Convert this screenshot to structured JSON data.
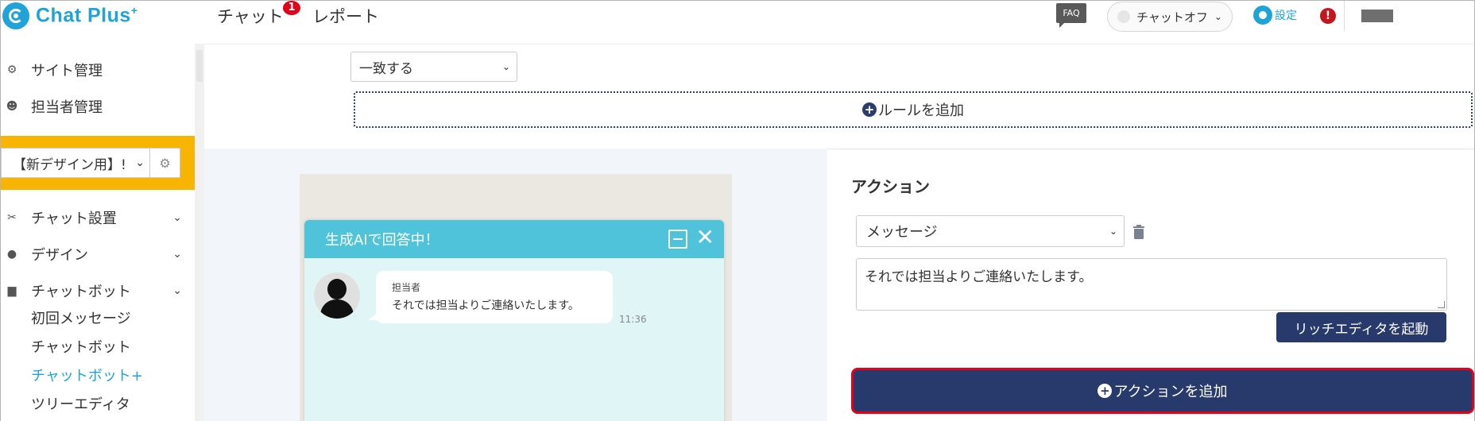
{
  "header": {
    "logo_text": "Chat Plus",
    "logo_sup": "+",
    "nav": [
      {
        "label": "チャット",
        "badge": "1"
      },
      {
        "label": "レポート"
      }
    ],
    "faq_label": "FAQ",
    "chat_status_label": "チャットオフ",
    "settings_label": "設定",
    "alert_label": "!"
  },
  "sidebar": {
    "items": [
      {
        "label": "サイト管理",
        "icon": "gear-icon"
      },
      {
        "label": "担当者管理",
        "icon": "users-icon"
      }
    ],
    "design_select_value": "【新デザイン用】!",
    "sections": [
      {
        "label": "チャット設置",
        "icon": "tools-icon"
      },
      {
        "label": "デザイン",
        "icon": "palette-icon"
      },
      {
        "label": "チャットボット",
        "icon": "chat-icon"
      }
    ],
    "sub_items": [
      {
        "label": "初回メッセージ"
      },
      {
        "label": "チャットボット"
      },
      {
        "label": "チャットボット+",
        "active": true
      },
      {
        "label": "ツリーエディタ"
      }
    ]
  },
  "rules": {
    "match_select_value": "一致する",
    "add_rule_label": "ルールを追加"
  },
  "preview": {
    "chat_title": "生成AIで回答中！",
    "agent_name": "担当者",
    "message": "それでは担当よりご連絡いたします。",
    "time": "11:36"
  },
  "action": {
    "title": "アクション",
    "type_select_value": "メッセージ",
    "message_text": "それでは担当よりご連絡いたします。",
    "rich_editor_label": "リッチエディタを起動",
    "add_action_label": "アクションを追加"
  },
  "colors": {
    "brand": "#1fa3d8",
    "navy": "#273a6b",
    "highlight": "#f7b400",
    "alert": "#e2001a"
  }
}
